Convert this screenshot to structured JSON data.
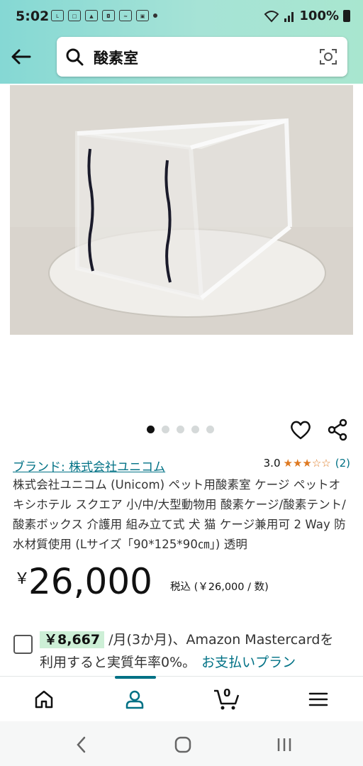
{
  "status_bar": {
    "time": "5:02",
    "battery": "100%",
    "icons": [
      "line-icon",
      "app-icon",
      "alert-icon",
      "camera-icon",
      "wifi-call-icon",
      "gallery-icon"
    ]
  },
  "search": {
    "query": "酸素室"
  },
  "product": {
    "image_alt": "",
    "carousel": {
      "total": 5,
      "active": 0
    },
    "brand_link": "ブランド: 株式会社ユニコム",
    "rating_value": "3.0",
    "rating_stars": "★★★☆☆",
    "rating_count": "(2)",
    "title": "株式会社ユニコム (Unicom) ペット用酸素室 ケージ ペットオキシホテル スクエア 小/中/大型動物用 酸素ケージ/酸素テント/酸素ボックス 介護用 組み立て式 犬 猫 ケージ兼用可 2 Way 防水材質使用 (Lサイズ「90*125*90㎝」) 透明",
    "price_symbol": "￥",
    "price": "26,000",
    "price_note": "税込 (￥26,000 / 数)"
  },
  "installment": {
    "amount": "￥8,667",
    "line1_rest": "/月(3か月)、Amazon Mastercardを",
    "line2": "利用すると実質年率0%。",
    "link": "お支払いプラン"
  },
  "bottom_nav": {
    "cart_count": "0",
    "items": [
      "home-icon",
      "account-icon",
      "cart-icon",
      "menu-icon"
    ],
    "active": "account"
  },
  "colors": {
    "accent": "#007185",
    "star": "#de7921",
    "header_gradient_start": "#85d8d4",
    "header_gradient_end": "#a8e6cf"
  }
}
